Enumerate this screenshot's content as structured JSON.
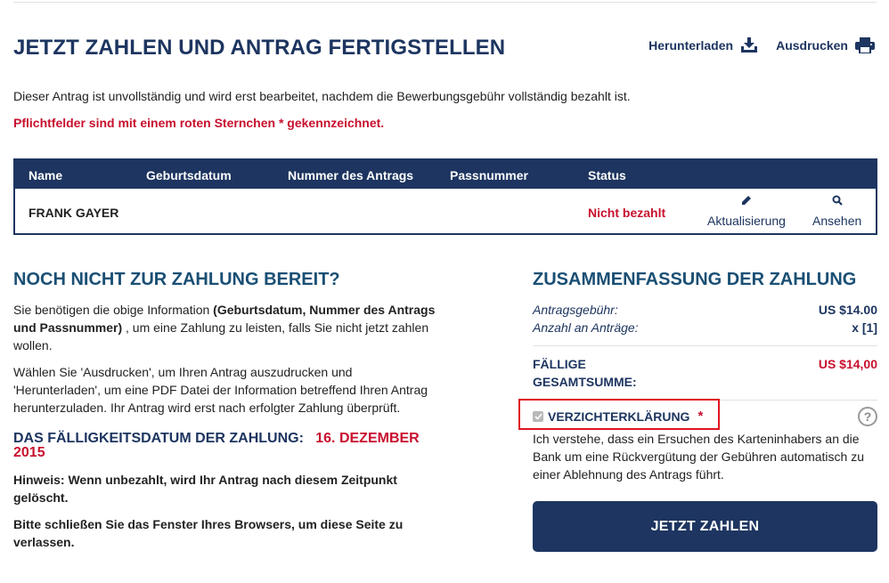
{
  "header": {
    "title": "JETZT ZAHLEN UND ANTRAG FERTIGSTELLEN",
    "download_label": "Herunterladen",
    "print_label": "Ausdrucken"
  },
  "intro_text": "Dieser Antrag ist unvollständig und wird erst bearbeitet, nachdem die Bewerbungsgebühr vollständig bezahlt ist.",
  "required_note": "Pflichtfelder sind mit einem roten Sternchen * gekennzeichnet.",
  "table": {
    "columns": [
      "Name",
      "Geburtsdatum",
      "Nummer des Antrags",
      "Passnummer",
      "Status"
    ],
    "row": {
      "name": "FRANK GAYER",
      "status": "Nicht bezahlt",
      "update_label": "Aktualisierung",
      "view_label": "Ansehen"
    }
  },
  "not_ready": {
    "heading": "NOCH NICHT ZUR ZAHLUNG BEREIT?",
    "p1_a": "Sie benötigen die obige Information ",
    "p1_b": "(Geburtsdatum, Nummer des Antrags und Passnummer)",
    "p1_c": " , um eine Zahlung zu leisten, falls Sie nicht jetzt zahlen wollen.",
    "p2": "Wählen Sie 'Ausdrucken', um Ihren Antrag auszudrucken und 'Herunterladen', um eine PDF Datei der Information betreffend Ihren Antrag herunterzuladen. Ihr Antrag wird erst nach erfolgter Zahlung überprüft.",
    "due_label": "DAS FÄLLIGKEITSDATUM DER ZAHLUNG:",
    "due_date": "16. DEZEMBER 2015",
    "notice": "Hinweis: Wenn unbezahlt, wird Ihr Antrag nach diesem Zeitpunkt gelöscht.",
    "close_note": "Bitte schließen Sie das Fenster Ihres Browsers, um diese Seite zu verlassen."
  },
  "summary": {
    "heading": "ZUSAMMENFASSUNG DER ZAHLUNG",
    "fee_label": "Antragsgebühr:",
    "fee_value": "US $14.00",
    "count_label": "Anzahl an Anträge:",
    "count_value": "x [1]",
    "total_label_1": "FÄLLIGE",
    "total_label_2": "GESAMTSUMME:",
    "total_value": "US $14,00",
    "waiver_label": "VERZICHTERKLÄRUNG",
    "waiver_star": "*",
    "waiver_checked": true,
    "help_glyph": "?",
    "waiver_text": "Ich verstehe, dass ein Ersuchen des Karteninhabers an die Bank um eine Rückvergütung der Gebühren automatisch zu einer Ablehnung des Antrags führt.",
    "pay_button": "JETZT ZAHLEN"
  },
  "icons": {
    "download": "download-tray-icon",
    "print": "printer-icon",
    "update": "pencil-icon",
    "view": "magnifier-icon",
    "help": "question-circle-icon",
    "checkbox": "checkmark-icon"
  },
  "colors": {
    "navy": "#1d3560",
    "heading_blue": "#1a4f74",
    "red": "#c8102e",
    "highlight_border": "#e0141e"
  }
}
